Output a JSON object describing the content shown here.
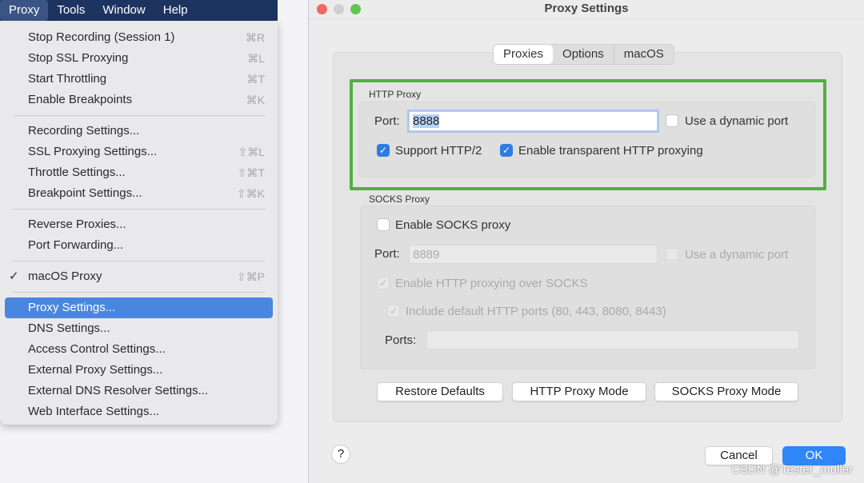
{
  "menubar": {
    "items": [
      "Proxy",
      "Tools",
      "Window",
      "Help"
    ]
  },
  "menu": {
    "groups": [
      [
        {
          "label": "Stop Recording (Session 1)",
          "shortcut": "⌘R"
        },
        {
          "label": "Stop SSL Proxying",
          "shortcut": "⌘L"
        },
        {
          "label": "Start Throttling",
          "shortcut": "⌘T"
        },
        {
          "label": "Enable Breakpoints",
          "shortcut": "⌘K"
        }
      ],
      [
        {
          "label": "Recording Settings...",
          "shortcut": ""
        },
        {
          "label": "SSL Proxying Settings...",
          "shortcut": "⇧⌘L"
        },
        {
          "label": "Throttle Settings...",
          "shortcut": "⇧⌘T"
        },
        {
          "label": "Breakpoint Settings...",
          "shortcut": "⇧⌘K"
        }
      ],
      [
        {
          "label": "Reverse Proxies...",
          "shortcut": ""
        },
        {
          "label": "Port Forwarding...",
          "shortcut": ""
        }
      ],
      [
        {
          "label": "macOS Proxy",
          "shortcut": "⇧⌘P",
          "checked": true
        }
      ],
      [
        {
          "label": "Proxy Settings...",
          "shortcut": "",
          "highlighted": true
        },
        {
          "label": "DNS Settings...",
          "shortcut": ""
        },
        {
          "label": "Access Control Settings...",
          "shortcut": ""
        },
        {
          "label": "External Proxy Settings...",
          "shortcut": ""
        },
        {
          "label": "External DNS Resolver Settings...",
          "shortcut": ""
        },
        {
          "label": "Web Interface Settings...",
          "shortcut": ""
        }
      ]
    ],
    "check": "✓"
  },
  "dialog": {
    "title": "Proxy Settings",
    "tabs": [
      "Proxies",
      "Options",
      "macOS"
    ],
    "http": {
      "section": "HTTP Proxy",
      "port_label": "Port:",
      "port": "8888",
      "dynamic": "Use a dynamic port",
      "http2": "Support HTTP/2",
      "transparent": "Enable transparent HTTP proxying"
    },
    "socks": {
      "section": "SOCKS Proxy",
      "enable": "Enable SOCKS proxy",
      "port_label": "Port:",
      "port": "8889",
      "dynamic": "Use a dynamic port",
      "over_socks": "Enable HTTP proxying over SOCKS",
      "default_ports": "Include default HTTP ports (80, 443, 8080, 8443)",
      "ports_label": "Ports:",
      "ports": ""
    },
    "buttons": {
      "restore": "Restore Defaults",
      "http_mode": "HTTP Proxy Mode",
      "socks_mode": "SOCKS Proxy Mode",
      "help": "?",
      "cancel": "Cancel",
      "ok": "OK"
    }
  },
  "watermark": "CSDN @Tester_muller",
  "colors": {
    "highlight": "#52b043",
    "accent": "#2f7de1",
    "menubar": "#1d3461"
  }
}
